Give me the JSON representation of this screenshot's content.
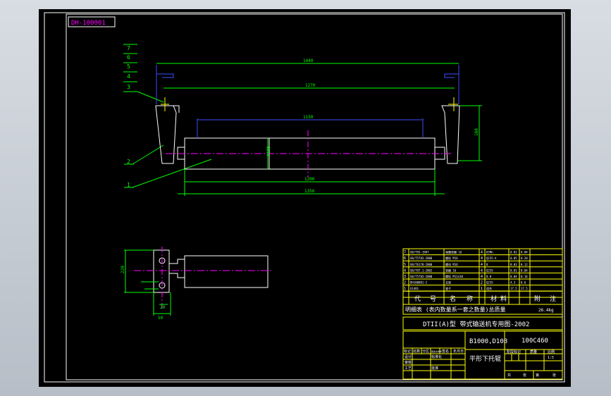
{
  "colors": {
    "background": "#000000",
    "frame": "#ffffff",
    "yellow": "#ffff00",
    "green": "#00ff00",
    "blue": "#3b4bff",
    "magenta": "#ff00ff",
    "window": "#c6ccd4"
  },
  "drawing": {
    "code": "DH-100001",
    "part_numbers": [
      "7",
      "6",
      "5",
      "4",
      "3",
      "2",
      "1"
    ],
    "dimensions": {
      "outer_length": "1440",
      "inner_length": "1270",
      "roller_face": "1150",
      "roller_total": "1200",
      "bottom_total": "1356",
      "diameter": "Φ108",
      "bracket_height": "160",
      "side_height": "220",
      "side_width": "50",
      "side_bottom": "20"
    }
  },
  "bom": {
    "rows": [
      {
        "no": "7",
        "code": "GB/T93-1987",
        "name": "弹簧垫圈 16",
        "qty": "4",
        "material": "65Mn",
        "w1": "0.01",
        "w2": "0.04"
      },
      {
        "no": "6",
        "code": "GB/T5783-2000",
        "name": "螺栓 M16",
        "qty": "4",
        "material": "Q235-A",
        "w1": "0.05",
        "w2": "0.20"
      },
      {
        "no": "5",
        "code": "GB/T6170-2000",
        "name": "螺母 M16",
        "qty": "4",
        "material": "8",
        "w1": "0.03",
        "w2": "0.12"
      },
      {
        "no": "4",
        "code": "GB/T97.1-2002",
        "name": "垫圈 16",
        "qty": "4",
        "material": "Q235",
        "w1": "0.01",
        "w2": "0.04"
      },
      {
        "no": "3",
        "code": "GB/T5783-2000",
        "name": "螺栓 M12x30",
        "qty": "4",
        "material": "8.8",
        "w1": "0.04",
        "w2": "0.16"
      },
      {
        "no": "2",
        "code": "DH100001-2",
        "name": "支架",
        "qty": "2",
        "material": "Q235",
        "w1": "4.3",
        "w2": "8.6"
      },
      {
        "no": "1",
        "code": "G1401",
        "name": "辊子",
        "qty": "1",
        "material": "组合",
        "w1": "17.5",
        "w2": "17.5"
      }
    ],
    "headers": [
      "序号",
      "代号",
      "名称",
      "数量",
      "材料",
      "单件",
      "总计",
      "附注"
    ],
    "header_labels": [
      "代",
      "号",
      "名",
      "称",
      "材",
      "料",
      "附",
      "注"
    ],
    "note_line": "明细表 (表内数量系一套之数量)总质量",
    "total_weight": "26.4kg"
  },
  "title_block": {
    "series": "DTII(A)型 带式输送机专用图-2002",
    "belt_width": "B1000,D108",
    "drawing_code": "100C460",
    "part_name": "平形下托辊",
    "left_labels": [
      "标记",
      "处数",
      "分区",
      "更改文件号",
      "签名",
      "年月日"
    ],
    "role_labels": [
      "设计",
      "标准化",
      "审核",
      "工艺",
      "批准"
    ],
    "right_labels": [
      "阶段标记",
      "质量",
      "比例"
    ],
    "scale_value": "1:5",
    "sheet_labels": [
      "共",
      "张",
      "第",
      "张"
    ]
  }
}
